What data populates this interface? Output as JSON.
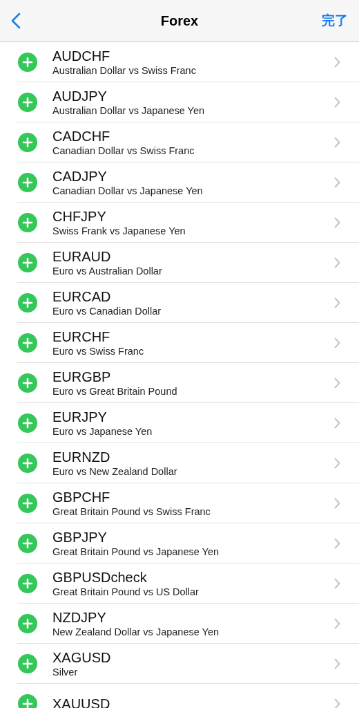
{
  "nav_bar": {
    "title": "Forex",
    "done_button": "完了"
  },
  "rows": [
    {
      "symbol": "AUDCHF",
      "description": "Australian Dollar vs Swiss Franc"
    },
    {
      "symbol": "AUDJPY",
      "description": "Australian Dollar vs Japanese Yen"
    },
    {
      "symbol": "CADCHF",
      "description": "Canadian Dollar vs Swiss Franc"
    },
    {
      "symbol": "CADJPY",
      "description": "Canadian Dollar vs Japanese Yen"
    },
    {
      "symbol": "CHFJPY",
      "description": "Swiss Frank vs Japanese Yen"
    },
    {
      "symbol": "EURAUD",
      "description": "Euro vs Australian Dollar"
    },
    {
      "symbol": "EURCAD",
      "description": "Euro vs Canadian Dollar"
    },
    {
      "symbol": "EURCHF",
      "description": "Euro vs Swiss Franc"
    },
    {
      "symbol": "EURGBP",
      "description": "Euro vs Great Britain Pound"
    },
    {
      "symbol": "EURJPY",
      "description": "Euro vs Japanese Yen"
    },
    {
      "symbol": "EURNZD",
      "description": "Euro vs New Zealand Dollar"
    },
    {
      "symbol": "GBPCHF",
      "description": "Great Britain Pound vs Swiss Franc"
    },
    {
      "symbol": "GBPJPY",
      "description": "Great Britain Pound vs Japanese Yen"
    },
    {
      "symbol": "GBPUSDcheck",
      "description": "Great Britain Pound vs US Dollar"
    },
    {
      "symbol": "NZDJPY",
      "description": "New Zealand Dollar vs Japanese Yen"
    },
    {
      "symbol": "XAGUSD",
      "description": "Silver"
    },
    {
      "symbol": "XAUUSD"
    }
  ]
}
